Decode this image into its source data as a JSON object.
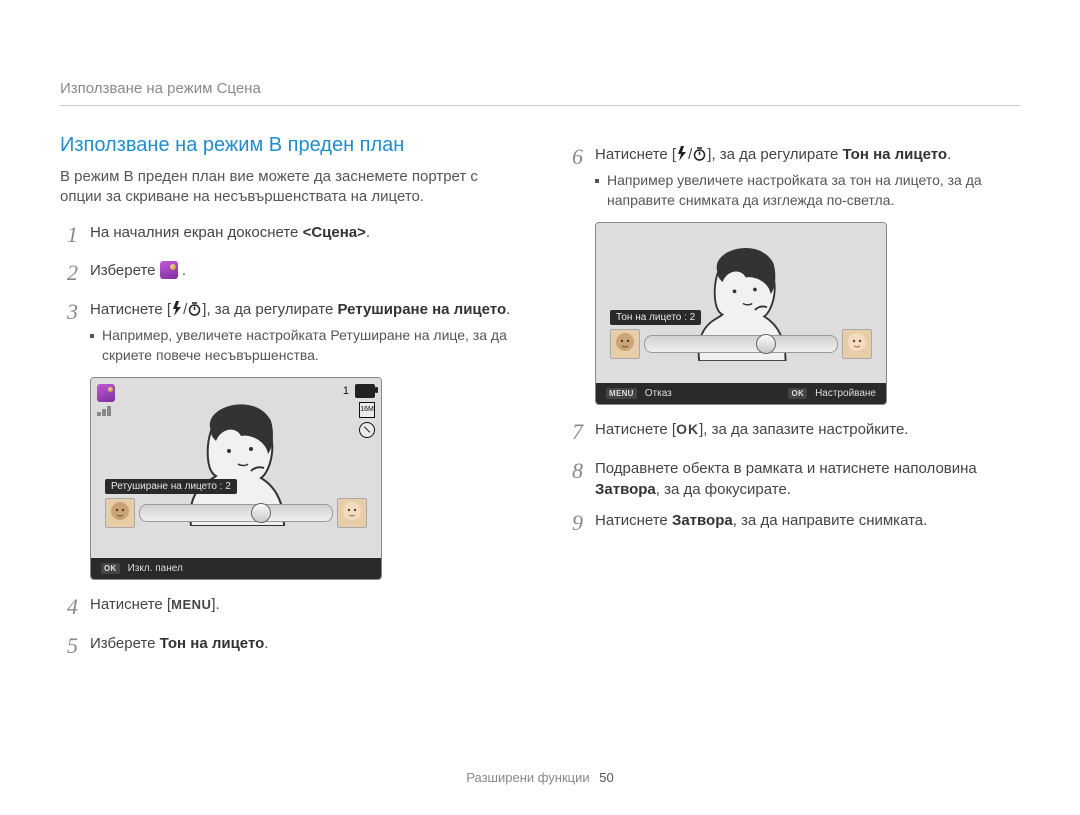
{
  "header": {
    "breadcrumb": "Използване на режим Сцена"
  },
  "section_title": "Използване на режим В преден план",
  "intro": "В режим В преден план вие можете да заснемете портрет с опции за скриване на несъвършенствата на лицето.",
  "steps": {
    "s1": {
      "num": "1",
      "pre": "На началния екран докоснете ",
      "bold": "<Сцена>",
      "post": "."
    },
    "s2": {
      "num": "2",
      "pre": "Изберете ",
      "post": "."
    },
    "s3": {
      "num": "3",
      "pre": "Натиснете [",
      "mid": "], за да регулирате ",
      "bold": "Ретуширане на лицето",
      "post": ".",
      "sub": "Например, увеличете настройката Ретуширане на лице, за да скриете повече несъвършенства."
    },
    "s4": {
      "num": "4",
      "pre": "Натиснете [",
      "post": "]."
    },
    "s5": {
      "num": "5",
      "pre": "Изберете ",
      "bold": "Тон на лицето",
      "post": "."
    },
    "s6": {
      "num": "6",
      "pre": "Натиснете [",
      "mid": "], за да регулирате ",
      "bold": "Тон на лицето",
      "post": ".",
      "sub": "Например увеличете настройката за тон на лицето, за да направите снимката да изглежда по-светла."
    },
    "s7": {
      "num": "7",
      "pre": "Натиснете [",
      "post": "], за да запазите настройките."
    },
    "s8": {
      "num": "8",
      "text_a": "Подравнете обекта в рамката и натиснете наполовина ",
      "bold": "Затвора",
      "text_b": ", за да фокусирате."
    },
    "s9": {
      "num": "9",
      "pre": "Натиснете ",
      "bold": "Затвора",
      "post": ", за да направите снимката."
    }
  },
  "screenshot_left": {
    "slider_label": "Ретуширане на лицето : 2",
    "hud_number": "1",
    "res_label": "16M",
    "footer_key": "OK",
    "footer_label": "Изкл. панел"
  },
  "screenshot_right": {
    "slider_label": "Тон на лицето : 2",
    "footer_left_key": "MENU",
    "footer_left_label": "Отказ",
    "footer_right_key": "OK",
    "footer_right_label": "Настройване"
  },
  "keys": {
    "menu": "MENU",
    "ok": "OK"
  },
  "page_footer": {
    "section": "Разширени функции",
    "page_number": "50"
  }
}
